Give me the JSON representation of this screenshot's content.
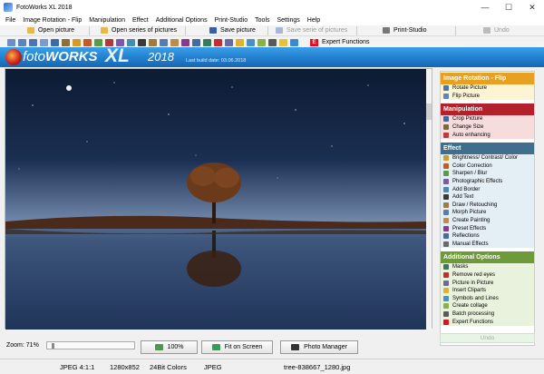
{
  "window": {
    "title": "FotoWorks XL 2018",
    "minimize": "—",
    "maximize": "☐",
    "close": "✕"
  },
  "menu": [
    "File",
    "Image Rotation - Flip",
    "Manipulation",
    "Effect",
    "Additional Options",
    "Print-Studio",
    "Tools",
    "Settings",
    "Help"
  ],
  "toolbar": {
    "open_picture": "Open picture",
    "open_series": "Open series of pictures",
    "save_picture": "Save picture",
    "save_series": "Save serie of pictures",
    "print_studio": "Print-Studio",
    "undo": "Undo",
    "expert_functions": "Expert Functions",
    "expert_badge": "E"
  },
  "banner": {
    "logo_foto": "foto",
    "logo_works": "WORKS",
    "logo_xl": "XL",
    "logo_year": "2018",
    "build_date": "Last build date: 03.06.2018"
  },
  "bottom": {
    "zoom_label": "Zoom: 71%",
    "zoom_value": 0.04,
    "btn_100": "100%",
    "btn_fit": "Fit on Screen",
    "btn_manager": "Photo Manager"
  },
  "status": {
    "format": "JPEG  4:1:1",
    "size": "1280x852",
    "colors": "24Bit Colors",
    "type": "JPEG",
    "filename": "tree-838667_1280.jpg"
  },
  "panel": {
    "rotation": {
      "title": "Image Rotation - Flip",
      "items": [
        "Rotate Picture",
        "Flip Picture"
      ]
    },
    "manipulation": {
      "title": "Manipulation",
      "items": [
        "Crop Picture",
        "Change Size",
        "Auto enhancing"
      ]
    },
    "effect": {
      "title": "Effect",
      "items": [
        "Brightness/ Contrast/ Color",
        "Color Correction",
        "Sharpen / Blur",
        "Photographic Effects",
        "Add Border",
        "Add Text",
        "Draw / Retouching",
        "Morph Picture",
        "Create Painting",
        "Preset Effects",
        "Reflections",
        "Manual Effects"
      ]
    },
    "additional": {
      "title": "Additional Options",
      "items": [
        "Masks",
        "Remove red eyes",
        "Picture in Picture",
        "Insert Cliparts",
        "Symbols and Lines",
        "Create collage",
        "Batch processing",
        "Expert Functions"
      ]
    },
    "undo": "Undo"
  },
  "colors": {
    "accent_blue": "#1f7ccc",
    "rotation": "#e8a020",
    "manipulation": "#b3212b",
    "effect": "#3f6f8c",
    "additional": "#6e9a3a"
  }
}
